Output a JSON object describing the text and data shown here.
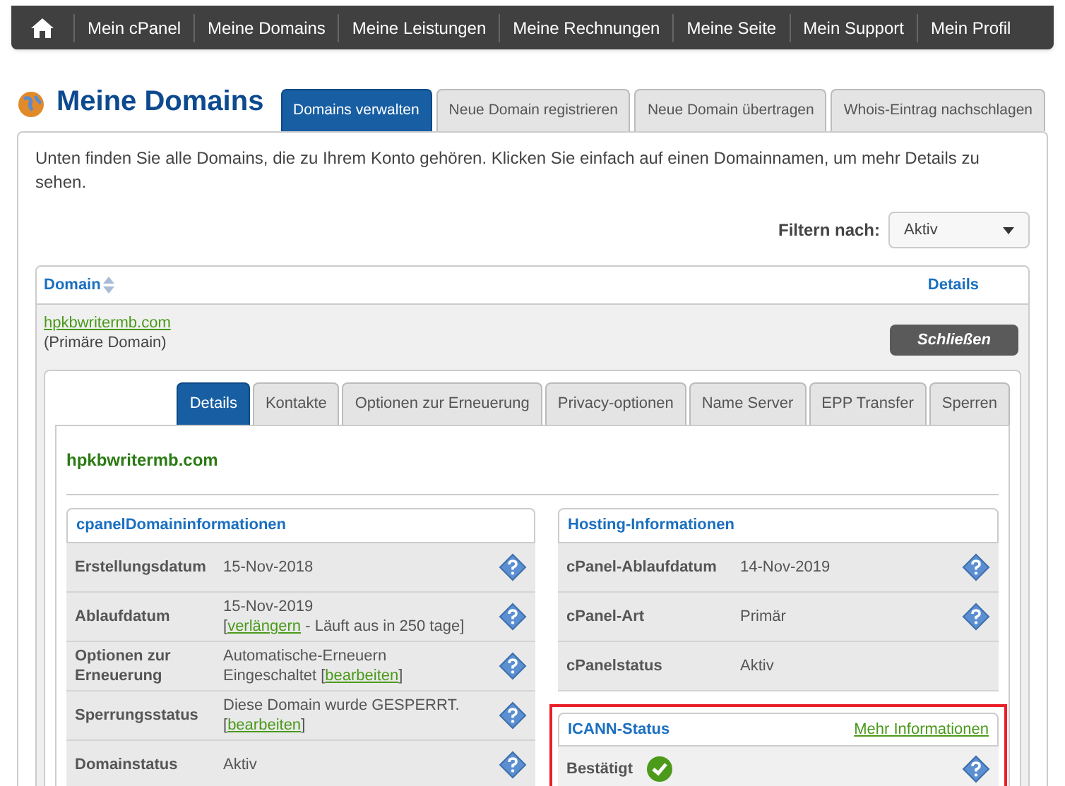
{
  "nav": {
    "items": [
      {
        "label": "Mein cPanel"
      },
      {
        "label": "Meine Domains"
      },
      {
        "label": "Meine Leistungen"
      },
      {
        "label": "Meine Rechnungen"
      },
      {
        "label": "Meine Seite"
      },
      {
        "label": "Mein Support"
      },
      {
        "label": "Mein Profil"
      }
    ]
  },
  "page": {
    "title": "Meine Domains"
  },
  "tabs": [
    {
      "label": "Domains verwalten",
      "selected": true
    },
    {
      "label": "Neue Domain registrieren",
      "selected": false
    },
    {
      "label": "Neue Domain übertragen",
      "selected": false
    },
    {
      "label": "Whois-Eintrag nachschlagen",
      "selected": false
    }
  ],
  "intro": "Unten finden Sie alle Domains, die zu Ihrem Konto gehören. Klicken Sie einfach auf einen Domainnamen, um mehr Details zu sehen.",
  "filter": {
    "label": "Filtern nach:",
    "value": "Aktiv"
  },
  "table": {
    "columns": [
      "Domain",
      "Details"
    ],
    "rows": [
      {
        "domain": "hpkbwritermb.com",
        "note": "(Primäre Domain)",
        "button": "Schließen",
        "expanded": true
      }
    ]
  },
  "detail_tabs": [
    {
      "label": "Details",
      "selected": true
    },
    {
      "label": "Kontakte",
      "selected": false
    },
    {
      "label": "Optionen zur Erneuerung",
      "selected": false
    },
    {
      "label": "Privacy-optionen",
      "selected": false
    },
    {
      "label": "Name Server",
      "selected": false
    },
    {
      "label": "EPP Transfer",
      "selected": false
    },
    {
      "label": "Sperren",
      "selected": false
    }
  ],
  "detail": {
    "domain": "hpkbwritermb.com",
    "domain_info": {
      "title": "cpanelDomaininformationen",
      "rows": [
        {
          "label": "Erstellungsdatum",
          "lines": [
            [
              {
                "kind": "text",
                "text": "15-Nov-2018"
              }
            ]
          ],
          "help": true
        },
        {
          "label": "Ablaufdatum",
          "lines": [
            [
              {
                "kind": "text",
                "text": "15-Nov-2019"
              }
            ],
            [
              {
                "kind": "text",
                "text": "["
              },
              {
                "kind": "link",
                "text": "verlängern"
              },
              {
                "kind": "text",
                "text": " - Läuft aus in 250 tage]"
              }
            ]
          ],
          "help": true
        },
        {
          "label": "Optionen zur Erneuerung",
          "lines": [
            [
              {
                "kind": "text",
                "text": "Automatische-Erneuern"
              }
            ],
            [
              {
                "kind": "text",
                "text": "Eingeschaltet ["
              },
              {
                "kind": "link",
                "text": "bearbeiten"
              },
              {
                "kind": "text",
                "text": "]"
              }
            ]
          ],
          "help": true
        },
        {
          "label": "Sperrungsstatus",
          "lines": [
            [
              {
                "kind": "text",
                "text": "Diese Domain wurde GESPERRT."
              }
            ],
            [
              {
                "kind": "text",
                "text": "["
              },
              {
                "kind": "link",
                "text": "bearbeiten"
              },
              {
                "kind": "text",
                "text": "]"
              }
            ]
          ],
          "help": true
        },
        {
          "label": "Domainstatus",
          "lines": [
            [
              {
                "kind": "text",
                "text": "Aktiv"
              }
            ]
          ],
          "help": true
        }
      ]
    },
    "hosting_info": {
      "title": "Hosting-Informationen",
      "rows": [
        {
          "label": "cPanel-Ablaufdatum",
          "lines": [
            [
              {
                "kind": "text",
                "text": "14-Nov-2019"
              }
            ]
          ],
          "help": true
        },
        {
          "label": "cPanel-Art",
          "lines": [
            [
              {
                "kind": "text",
                "text": "Primär"
              }
            ]
          ],
          "help": true
        },
        {
          "label": "cPanelstatus",
          "lines": [
            [
              {
                "kind": "text",
                "text": "Aktiv"
              }
            ]
          ],
          "help": false
        }
      ]
    },
    "icann": {
      "title": "ICANN-Status",
      "link": "Mehr Informationen",
      "status": "Bestätigt",
      "verified": true,
      "highlighted": true
    }
  }
}
